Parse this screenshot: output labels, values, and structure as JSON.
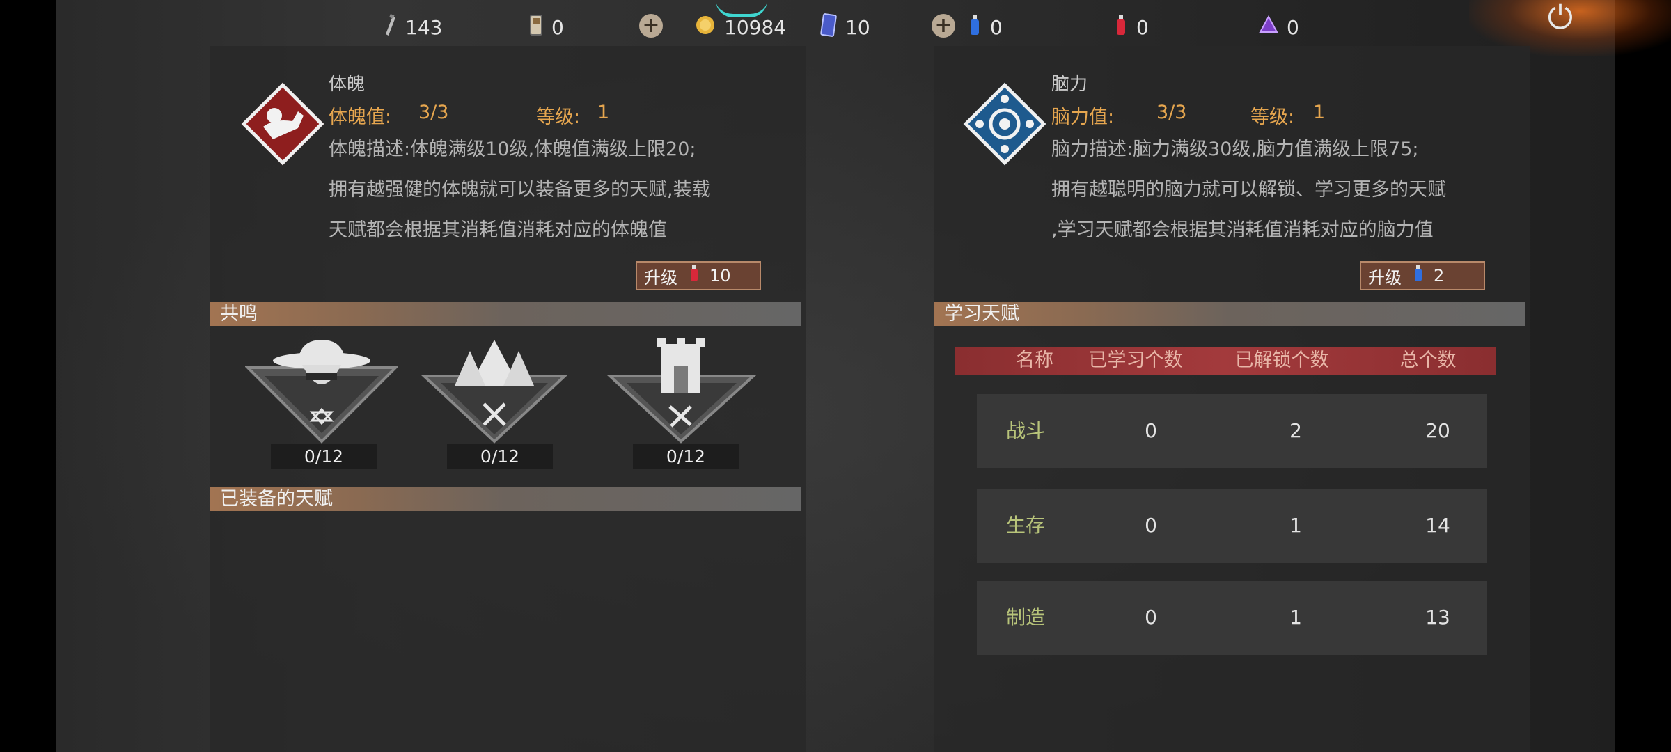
{
  "resources": [
    {
      "icon": "bullet-icon",
      "value": "143"
    },
    {
      "icon": "card-icon",
      "value": "0"
    },
    {
      "icon": "coin-icon",
      "value": "10984"
    },
    {
      "icon": "blue-card-icon",
      "value": "10"
    },
    {
      "icon": "blue-potion-icon",
      "value": "0"
    },
    {
      "icon": "red-potion-icon",
      "value": "0"
    },
    {
      "icon": "purple-crystal-icon",
      "value": "0"
    }
  ],
  "physique": {
    "title": "体魄",
    "value_label": "体魄值:",
    "value": "3/3",
    "level_label": "等级:",
    "level": "1",
    "desc_lines": [
      "体魄描述:体魄满级10级,体魄值满级上限20;",
      "拥有越强健的体魄就可以装备更多的天赋,装载",
      "天赋都会根据其消耗值消耗对应的体魄值"
    ],
    "upgrade_label": "升级",
    "upgrade_cost": "10"
  },
  "resonance": {
    "title": "共鸣",
    "badges": [
      {
        "name": "cowboy-badge",
        "count": "0/12"
      },
      {
        "name": "forest-badge",
        "count": "0/12"
      },
      {
        "name": "tower-badge",
        "count": "0/12"
      }
    ]
  },
  "equipped": {
    "title": "已装备的天赋"
  },
  "brain": {
    "title": "脑力",
    "value_label": "脑力值:",
    "value": "3/3",
    "level_label": "等级:",
    "level": "1",
    "desc_lines": [
      "脑力描述:脑力满级30级,脑力值满级上限75;",
      "拥有越聪明的脑力就可以解锁、学习更多的天赋",
      ",学习天赋都会根据其消耗值消耗对应的脑力值"
    ],
    "upgrade_label": "升级",
    "upgrade_cost": "2"
  },
  "learning": {
    "title": "学习天赋",
    "columns": [
      "名称",
      "已学习个数",
      "已解锁个数",
      "总个数"
    ],
    "rows": [
      {
        "name": "战斗",
        "learned": "0",
        "unlocked": "2",
        "total": "20"
      },
      {
        "name": "生存",
        "learned": "0",
        "unlocked": "1",
        "total": "14"
      },
      {
        "name": "制造",
        "learned": "0",
        "unlocked": "1",
        "total": "13"
      }
    ]
  },
  "colors": {
    "accent": "#e6a64f",
    "category": "#b8c47a",
    "header": "#a33a3c"
  }
}
